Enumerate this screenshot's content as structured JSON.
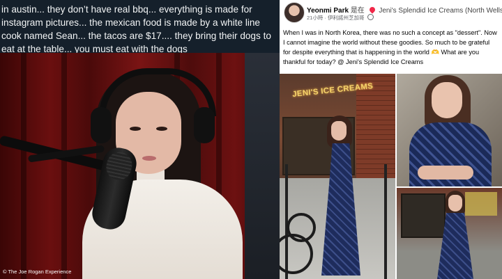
{
  "tweet": {
    "text": "in austin... they don’t have real bbq... everything is made for instagram pictures... the mexican food is made by a white line cook named Sean... the tacos are $17.... they bring their dogs to eat at the table... you must eat with the dogs"
  },
  "video": {
    "watermark": "© The Joe Rogan Experience"
  },
  "fb_post": {
    "author": "Yeonmi Park",
    "checkin_prefix": "是在",
    "location": "Jeni's Splendid Ice Creams (North Wells)",
    "time": "21小時",
    "place": "伊利諾州芝加哥",
    "body_before": "When I was in North Korea, there was no such a concept as \"dessert\". Now I cannot imagine the world without these goodies. So much to be grateful for despite everything that is happening in the world",
    "body_after": "What are you thankful for today? @ Jeni's Splendid Ice Creams",
    "emoji": "heart-hands"
  },
  "photos": {
    "store_sign": "JENI'S ICE CREAMS"
  },
  "colors": {
    "twitter_bg": "#15202b",
    "facebook_bg": "#ffffff"
  }
}
